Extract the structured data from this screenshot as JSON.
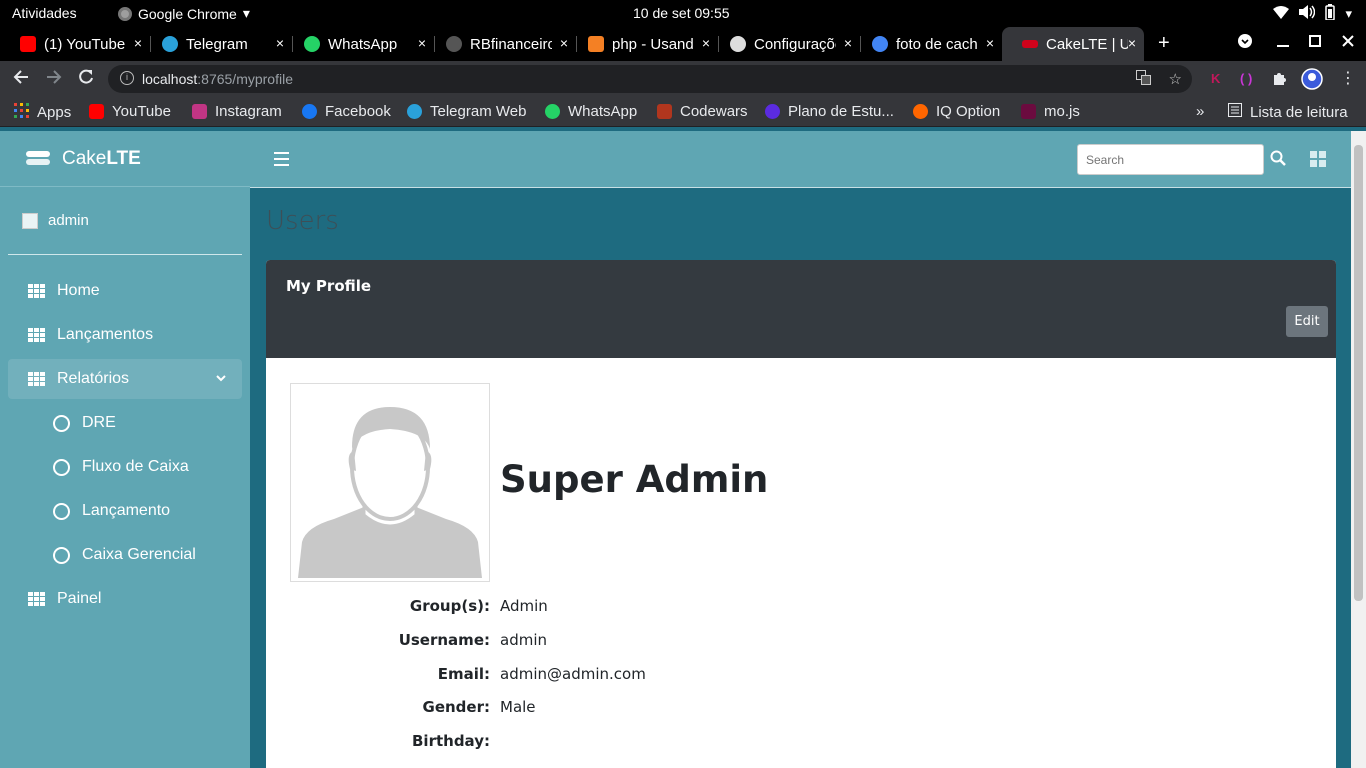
{
  "system": {
    "activities": "Atividades",
    "app_name": "Google Chrome",
    "app_menu_icon": "chevron-down-icon",
    "clock": "10 de set  09:55",
    "tray_icons": [
      "wifi-icon",
      "volume-icon",
      "battery-icon",
      "chevron-down-icon"
    ]
  },
  "browser": {
    "tabs": [
      {
        "title": "(1) YouTube",
        "color": "#ff0000"
      },
      {
        "title": "Telegram",
        "color": "#2aa1da"
      },
      {
        "title": "WhatsApp",
        "color": "#25d366"
      },
      {
        "title": "RBfinanceiro",
        "color": "#555555"
      },
      {
        "title": "php - Usando",
        "color": "#f48024"
      },
      {
        "title": "Configurações",
        "color": "#dddddd"
      },
      {
        "title": "foto de cache",
        "color": "#4285f4"
      },
      {
        "title": "CakeLTE | Users",
        "color": "#d0021b"
      }
    ],
    "tab_close": "×",
    "new_tab": "+",
    "url_host": "localhost",
    "url_path": ":8765/myprofile",
    "bookmarks": [
      {
        "label": "Apps",
        "color": "#e94235"
      },
      {
        "label": "YouTube",
        "color": "#ff0000"
      },
      {
        "label": "Instagram",
        "color": "#c13584"
      },
      {
        "label": "Facebook",
        "color": "#1877f2"
      },
      {
        "label": "Telegram Web",
        "color": "#2aa1da"
      },
      {
        "label": "WhatsApp",
        "color": "#25d366"
      },
      {
        "label": "Codewars",
        "color": "#b1361e"
      },
      {
        "label": "Plano de Estu...",
        "color": "#5b2be0"
      },
      {
        "label": "IQ Option",
        "color": "#ff6600"
      },
      {
        "label": "mo.js",
        "color": "#6b0b3f"
      }
    ],
    "bookmarks_overflow": "»",
    "reading_list": "Lista de leitura"
  },
  "app": {
    "brand_prefix": "Cake",
    "brand_suffix": "LTE",
    "user_name": "admin",
    "nav": [
      {
        "label": "Home"
      },
      {
        "label": "Lançamentos"
      },
      {
        "label": "Relatórios"
      }
    ],
    "subnav": [
      {
        "label": "DRE"
      },
      {
        "label": "Fluxo de Caixa"
      },
      {
        "label": "Lançamento"
      },
      {
        "label": "Caixa Gerencial"
      }
    ],
    "nav_last": "Painel",
    "search_placeholder": "Search",
    "page_title": "Users",
    "card_title": "My Profile",
    "edit_label": "Edit",
    "full_name": "Super Admin",
    "fields": [
      {
        "key": "Group(s):",
        "value": "Admin"
      },
      {
        "key": "Username:",
        "value": "admin"
      },
      {
        "key": "Email:",
        "value": "admin@admin.com"
      },
      {
        "key": "Gender:",
        "value": "Male"
      },
      {
        "key": "Birthday:",
        "value": ""
      }
    ]
  },
  "colors": {
    "sidebar": "#5fa6b3",
    "content_bg": "#1e6b80",
    "card_header": "#343a40"
  }
}
